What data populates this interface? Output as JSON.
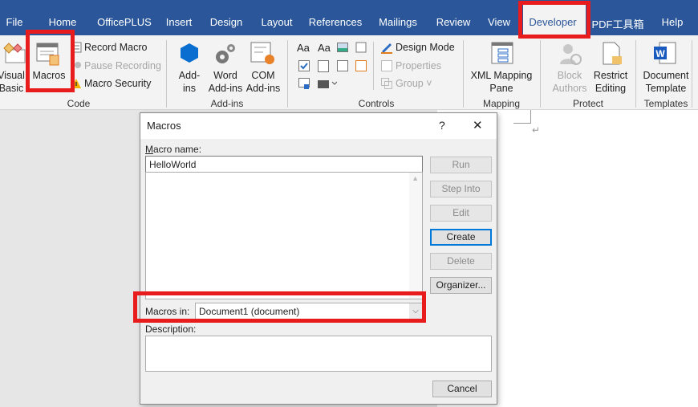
{
  "tabs": [
    "File",
    "Home",
    "OfficePLUS",
    "Insert",
    "Design",
    "Layout",
    "References",
    "Mailings",
    "Review",
    "View",
    "Developer",
    "PDF工具箱",
    "Help"
  ],
  "active_tab": "Developer",
  "ribbon": {
    "code": {
      "label": "Code",
      "visual_basic": "Visual\nBasic",
      "macros": "Macros",
      "record_macro": "Record Macro",
      "pause_recording": "Pause Recording",
      "macro_security": "Macro Security"
    },
    "addins": {
      "label": "Add-ins",
      "addins": "Add-\nins",
      "word_addins": "Word\nAdd-ins",
      "com_addins": "COM\nAdd-ins"
    },
    "controls": {
      "label": "Controls",
      "design_mode": "Design Mode",
      "properties": "Properties",
      "group": "Group"
    },
    "mapping": {
      "label": "Mapping",
      "xml_mapping": "XML Mapping\nPane"
    },
    "protect": {
      "label": "Protect",
      "block_authors": "Block\nAuthors",
      "restrict_editing": "Restrict\nEditing"
    },
    "templates": {
      "label": "Templates",
      "document_template": "Document\nTemplate"
    }
  },
  "dialog": {
    "title": "Macros",
    "help": "?",
    "close": "✕",
    "macro_name_label": "acro name:",
    "macro_name_accel": "M",
    "macro_name_value": "HelloWorld",
    "buttons": {
      "run": "Run",
      "step_into": "Step Into",
      "edit": "Edit",
      "create": "Create",
      "delete": "Delete",
      "organizer": "Organizer..."
    },
    "macros_in_label": "Macros in:",
    "macros_in_value": "Document1 (document)",
    "description_label": "Description:",
    "cancel": "Cancel"
  },
  "colors": {
    "ribbon_blue": "#2b579a",
    "highlight_red": "#e81c1c"
  }
}
